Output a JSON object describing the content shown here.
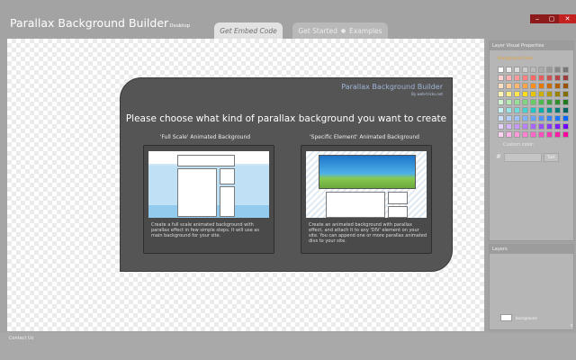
{
  "header": {
    "app_title": "Parallax Background Builder",
    "app_edition": "Desktop",
    "tabs": [
      {
        "label": "Get Embed Code"
      },
      {
        "label_a": "Get Started",
        "separator": "●",
        "label_b": "Examples"
      }
    ],
    "window": {
      "minimize": "‒",
      "maximize": "▢",
      "close": "✕"
    }
  },
  "dialog": {
    "brand": "Parallax Background Builder",
    "brand_sub": "By web-tricks.net",
    "title": "Please choose what kind of parallax background you want to create",
    "options": [
      {
        "caption": "'Full Scale' Animated Background",
        "text": "Create a full scale animated background with parallax effect in few simple steps. It will use as main background for your site."
      },
      {
        "caption": "'Specific Element' Animated Background",
        "text": "Create an animated background with parallax effect, and attach it to any 'DIV' element on your site. You can append one or more parallax animated divs to your site."
      }
    ]
  },
  "sidebar": {
    "visual_panel_title": "Layer Visual Properties",
    "bg_color_label": "Background Color",
    "custom_color_label": "Custom color:",
    "hash_symbol": "#",
    "custom_color_value": "",
    "set_label": "Set",
    "layers_panel_title": "Layers",
    "layers": [
      {
        "name": "background"
      }
    ],
    "delete_glyph": "x",
    "swatches": [
      "#ffffff",
      "#eeeeee",
      "#dddddd",
      "#cccccc",
      "#bbbbbb",
      "#aaaaaa",
      "#999999",
      "#888888",
      "#777777",
      "#ffd1d1",
      "#ffb3b3",
      "#ff9999",
      "#ff8080",
      "#ff6666",
      "#e65c5c",
      "#cc5252",
      "#b34747",
      "#993d3d",
      "#ffe0c2",
      "#ffcc99",
      "#ffb870",
      "#ffa347",
      "#ff8f1f",
      "#e67a00",
      "#cc6c00",
      "#b35f00",
      "#995100",
      "#fff5b3",
      "#ffee80",
      "#ffe64d",
      "#ffdd1a",
      "#e6c700",
      "#ccb000",
      "#b39a00",
      "#998400",
      "#806e00",
      "#d1f5d1",
      "#b3ebb3",
      "#99e099",
      "#80d680",
      "#66cc66",
      "#4db84d",
      "#3da33d",
      "#2e8f2e",
      "#1f7a1f",
      "#c2f0f0",
      "#99e6e6",
      "#70dbdb",
      "#47d1d1",
      "#1fc7c7",
      "#00adad",
      "#009494",
      "#007a7a",
      "#006161",
      "#cce0ff",
      "#b3d1ff",
      "#99c2ff",
      "#80b3ff",
      "#66a3ff",
      "#4d94ff",
      "#3385ff",
      "#1a75ff",
      "#0066ff",
      "#e6d1ff",
      "#d6b3ff",
      "#c799ff",
      "#b880ff",
      "#a866ff",
      "#9a4dff",
      "#8b33ff",
      "#7c1aff",
      "#6d00ff",
      "#ffd1f0",
      "#ffb3e6",
      "#ff99db",
      "#ff80d1",
      "#ff66c7",
      "#ff4dbd",
      "#ff33b3",
      "#ff1aa8",
      "#ff009e"
    ]
  },
  "footer": {
    "contact_label": "Contact Us"
  }
}
